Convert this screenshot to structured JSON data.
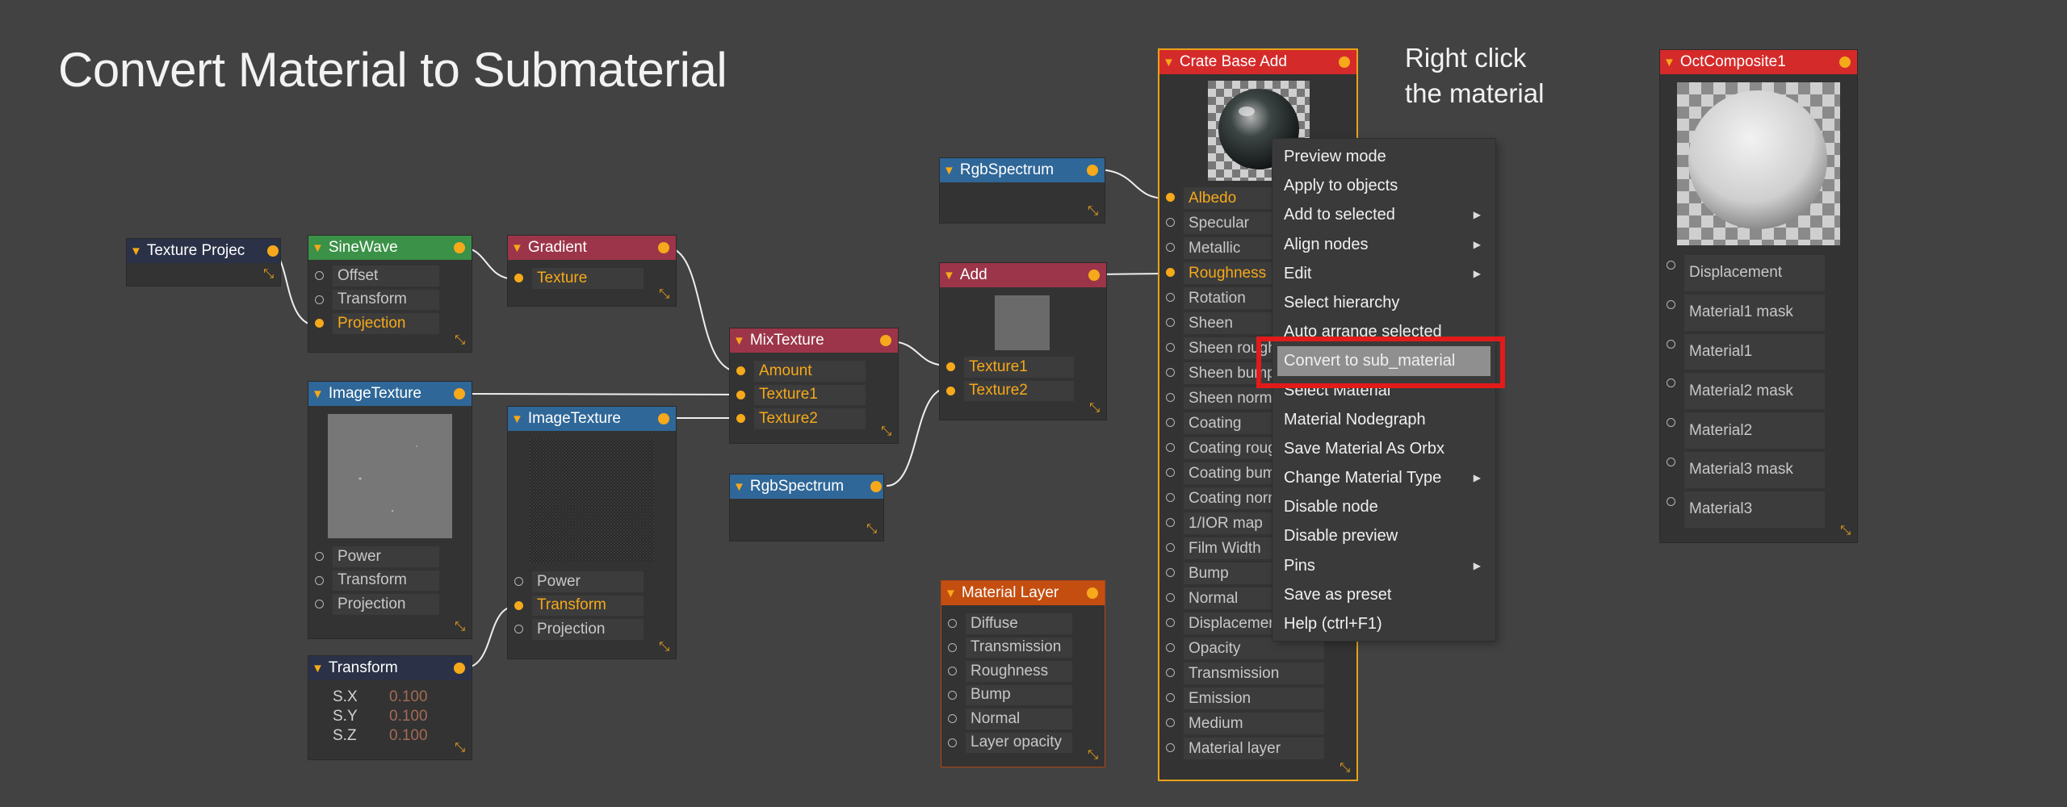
{
  "title": "Convert Material to Submaterial",
  "annotation": "Right click\nthe material",
  "colors": {
    "background": "#424242",
    "node_body": "#333333",
    "pin_accent": "#f6a91a",
    "header_blue": "#2f6798",
    "header_green": "#3a9147",
    "header_maroon": "#9c3549",
    "header_navy": "#2b3247",
    "header_orange": "#c44e10",
    "header_red": "#d52a2a",
    "highlight_box": "#e31a1a"
  },
  "nodes": {
    "texture_projection": {
      "title": "Texture Projec"
    },
    "sinewave": {
      "title": "SineWave",
      "pins": [
        "Offset",
        "Transform",
        "Projection"
      ]
    },
    "gradient": {
      "title": "Gradient",
      "pins": [
        "Texture"
      ]
    },
    "image_texture_1": {
      "title": "ImageTexture",
      "pins": [
        "Power",
        "Transform",
        "Projection"
      ]
    },
    "image_texture_2": {
      "title": "ImageTexture",
      "pins": [
        "Power",
        "Transform",
        "Projection"
      ]
    },
    "transform": {
      "title": "Transform",
      "params": [
        {
          "name": "S.X",
          "value": "0.100"
        },
        {
          "name": "S.Y",
          "value": "0.100"
        },
        {
          "name": "S.Z",
          "value": "0.100"
        }
      ]
    },
    "mix_texture": {
      "title": "MixTexture",
      "pins": [
        "Amount",
        "Texture1",
        "Texture2"
      ]
    },
    "rgb_spectrum_1": {
      "title": "RgbSpectrum"
    },
    "rgb_spectrum_2": {
      "title": "RgbSpectrum"
    },
    "add": {
      "title": "Add",
      "pins": [
        "Texture1",
        "Texture2"
      ]
    },
    "material_layer": {
      "title": "Material Layer",
      "pins": [
        "Diffuse",
        "Transmission",
        "Roughness",
        "Bump",
        "Normal",
        "Layer opacity"
      ]
    },
    "crate_base_add": {
      "title": "Crate Base Add",
      "pins": [
        "Albedo",
        "Specular",
        "Metallic",
        "Roughness",
        "Rotation",
        "Sheen",
        "Sheen rough",
        "Sheen bump",
        "Sheen norma",
        "Coating",
        "Coating roug",
        "Coating bum",
        "Coating norm",
        "1/IOR map",
        "Film Width",
        "Bump",
        "Normal",
        "Displacemen",
        "Opacity",
        "Transmission",
        "Emission",
        "Medium",
        "Material layer"
      ]
    },
    "oct_composite": {
      "title": "OctComposite1",
      "pins": [
        "Displacement",
        "Material1 mask",
        "Material1",
        "Material2 mask",
        "Material2",
        "Material3 mask",
        "Material3"
      ]
    }
  },
  "context_menu": {
    "items": [
      {
        "label": "Preview mode",
        "submenu": false
      },
      {
        "label": "Apply to objects",
        "submenu": false
      },
      {
        "label": "Add to selected",
        "submenu": true
      },
      {
        "label": "Align nodes",
        "submenu": true
      },
      {
        "label": "Edit",
        "submenu": true
      },
      {
        "label": "Select hierarchy",
        "submenu": false
      },
      {
        "label": "Auto arrange selected",
        "submenu": false
      },
      {
        "label": "Convert to sub_material",
        "submenu": false,
        "highlighted": true
      },
      {
        "label": "Select Material",
        "submenu": false
      },
      {
        "label": "Material Nodegraph",
        "submenu": false
      },
      {
        "label": "Save Material As Orbx",
        "submenu": false
      },
      {
        "label": "Change Material Type",
        "submenu": true
      },
      {
        "label": "Disable node",
        "submenu": false
      },
      {
        "label": "Disable preview",
        "submenu": false
      },
      {
        "label": "Pins",
        "submenu": true
      },
      {
        "label": "Save as preset",
        "submenu": false
      },
      {
        "label": "Help (ctrl+F1)",
        "submenu": false
      }
    ]
  }
}
